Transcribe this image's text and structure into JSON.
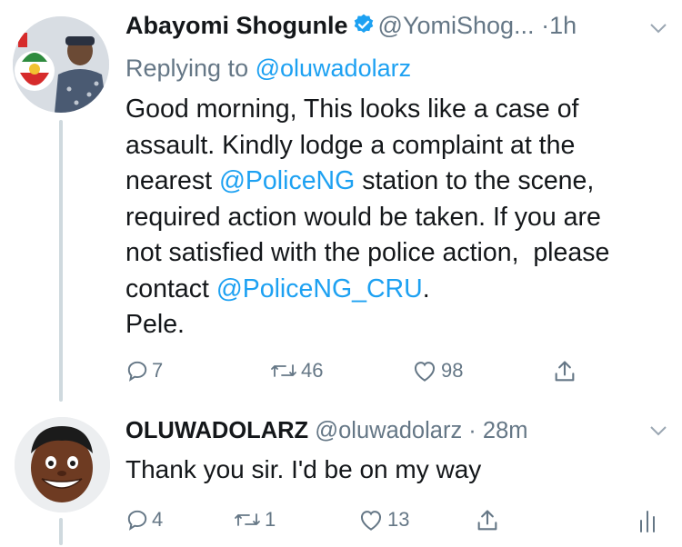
{
  "tweets": [
    {
      "author_name": "Abayomi Shogunle",
      "handle": "@YomiShog...",
      "dot": "·",
      "time": "1h",
      "reply_prefix": "Replying to ",
      "reply_handle": "@oluwadolarz",
      "body": [
        {
          "text": "Good morning, This looks like a case of"
        },
        {
          "text": "assault. Kindly lodge a complaint at the"
        },
        {
          "text": "nearest ",
          "mention": "@PoliceNG",
          "after": " station to the scene,"
        },
        {
          "text": "required action would be taken. If you are"
        },
        {
          "text": "not satisfied with the police action,  please"
        },
        {
          "text": "contact ",
          "mention": "@PoliceNG_CRU",
          "after": "."
        },
        {
          "text": "Pele."
        }
      ],
      "actions": {
        "replies": "7",
        "retweets": "46",
        "likes": "98"
      },
      "verified": true
    },
    {
      "author_name": "OLUWADOLARZ",
      "handle": "@oluwadolarz",
      "dot": "·",
      "time": "28m",
      "body_text": "Thank you sir. I'd be on my way",
      "actions": {
        "replies": "4",
        "retweets": "1",
        "likes": "13"
      }
    }
  ],
  "icons": {
    "verified": "verified-badge-icon",
    "chevron": "chevron-down-icon",
    "reply": "reply-icon",
    "retweet": "retweet-icon",
    "like": "heart-icon",
    "share": "share-icon",
    "analytics": "analytics-icon"
  },
  "colors": {
    "text": "#14171a",
    "secondary": "#657786",
    "link": "#1da1f2",
    "thread_line": "#cfd9de"
  }
}
